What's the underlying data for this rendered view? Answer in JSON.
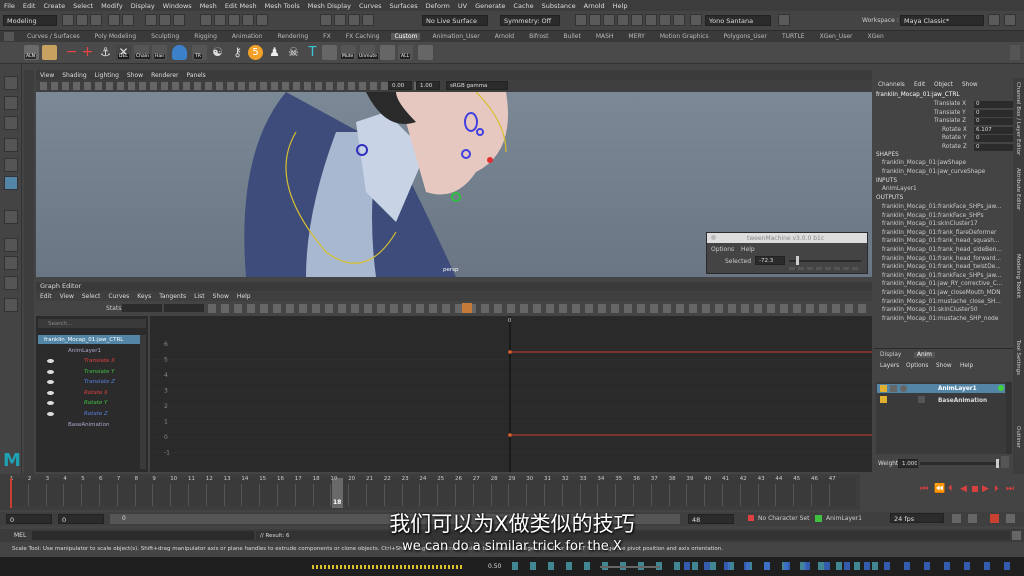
{
  "menubar": [
    "File",
    "Edit",
    "Create",
    "Select",
    "Modify",
    "Display",
    "Windows",
    "Mesh",
    "Edit Mesh",
    "Mesh Tools",
    "Mesh Display",
    "Curves",
    "Surfaces",
    "Deform",
    "UV",
    "Generate",
    "Cache",
    "Substance",
    "Arnold",
    "Help"
  ],
  "statusline": {
    "mode": "Modeling",
    "live_surface": "No Live Surface",
    "symmetry": "Symmetry: Off",
    "user": "Yono Santana",
    "workspace_label": "Workspace :",
    "workspace": "Maya Classic*"
  },
  "shelf_tabs": [
    "Curves / Surfaces",
    "Poly Modeling",
    "Sculpting",
    "Rigging",
    "Animation",
    "Rendering",
    "FX",
    "FX Caching",
    "Custom",
    "Animation_User",
    "Arnold",
    "Bifrost",
    "Bullet",
    "MASH",
    "MERY",
    "Motion Graphics",
    "Polygons_User",
    "TURTLE",
    "XGen_User",
    "XGen"
  ],
  "shelf_active": "Custom",
  "shelf_labels": [
    "ALN",
    "DEL",
    "Chain",
    "Hair",
    "TR",
    "Mute",
    "Unmute",
    "ALL"
  ],
  "viewport": {
    "menu": [
      "View",
      "Shading",
      "Lighting",
      "Show",
      "Renderer",
      "Panels"
    ],
    "field1": "0.00",
    "field2": "1.00",
    "color_space": "sRGB gamma",
    "camera": "persp"
  },
  "tween": {
    "title": "tweenMachine v3.0.0 b1c",
    "menu": [
      "Options",
      "Help"
    ],
    "label": "Selected",
    "value": "-72.3"
  },
  "graph_editor": {
    "title": "Graph Editor",
    "menu": [
      "Edit",
      "View",
      "Select",
      "Curves",
      "Keys",
      "Tangents",
      "List",
      "Show",
      "Help"
    ],
    "stats_label": "Stats",
    "search_placeholder": "Search...",
    "root": "franklin_Mocap_01:jaw_CTRL",
    "layer": "AnimLayer1",
    "channels": [
      {
        "label": "Translate X",
        "color": "#e04040"
      },
      {
        "label": "Translate Y",
        "color": "#40c040"
      },
      {
        "label": "Translate Z",
        "color": "#5a7fe0"
      },
      {
        "label": "Rotate X",
        "color": "#e04040"
      },
      {
        "label": "Rotate Y",
        "color": "#40c040"
      },
      {
        "label": "Rotate Z",
        "color": "#5a7fe0"
      }
    ],
    "base": "BaseAnimation",
    "y_ticks": [
      "6",
      "5",
      "4",
      "3",
      "2",
      "1",
      "0",
      "-1"
    ],
    "current_frame_marker": "0",
    "curve_color": "#c84030"
  },
  "channel_box": {
    "tabs": [
      "Channels",
      "Edit",
      "Object",
      "Show"
    ],
    "object": "franklin_Mocap_01:jaw_CTRL",
    "attrs": [
      {
        "name": "Translate X",
        "value": "0"
      },
      {
        "name": "Translate Y",
        "value": "0"
      },
      {
        "name": "Translate Z",
        "value": "0"
      },
      {
        "name": "Rotate X",
        "value": "6.107"
      },
      {
        "name": "Rotate Y",
        "value": "0"
      },
      {
        "name": "Rotate Z",
        "value": "0"
      }
    ],
    "shapes_header": "SHAPES",
    "shapes": [
      "franklin_Mocap_01:jawShape",
      "franklin_Mocap_01:jaw_curveShape"
    ],
    "inputs_header": "INPUTS",
    "inputs": [
      "AnimLayer1"
    ],
    "outputs_header": "OUTPUTS",
    "outputs": [
      "franklin_Mocap_01:frankFace_SHPs_jaw...",
      "franklin_Mocap_01:frankFace_SHPs",
      "franklin_Mocap_01:skinCluster17",
      "franklin_Mocap_01:frank_flareDeformer",
      "franklin_Mocap_01:frank_head_squash...",
      "franklin_Mocap_01:frank_head_sideBen...",
      "franklin_Mocap_01:frank_head_forward...",
      "franklin_Mocap_01:frank_head_twistDe...",
      "franklin_Mocap_01:frankFace_SHPs_jaw...",
      "franklin_Mocap_01:jaw_RY_corrective_C...",
      "franklin_Mocap_01:jaw_closeMouth_MDN",
      "franklin_Mocap_01:mustache_close_SH...",
      "franklin_Mocap_01:skinCluster50",
      "franklin_Mocap_01:mustache_SHP_node"
    ]
  },
  "layer_editor": {
    "tabs": [
      "Display",
      "Anim"
    ],
    "menu": [
      "Layers",
      "Options",
      "Show",
      "Help"
    ],
    "layers": [
      "AnimLayer1",
      "BaseAnimation"
    ],
    "weight_label": "Weight",
    "weight": "1.000"
  },
  "side_tabs": [
    "Channel Box / Layer Editor",
    "Attribute Editor",
    "Modeling Toolkit",
    "Tool Settings",
    "Outliner"
  ],
  "timeline": {
    "ticks": [
      "1",
      "2",
      "3",
      "4",
      "5",
      "6",
      "7",
      "8",
      "9",
      "10",
      "11",
      "12",
      "13",
      "14",
      "15",
      "16",
      "17",
      "18",
      "19",
      "20",
      "21",
      "22",
      "23",
      "24",
      "25",
      "26",
      "27",
      "28",
      "29",
      "30",
      "31",
      "32",
      "33",
      "34",
      "35",
      "36",
      "37",
      "38",
      "39",
      "40",
      "41",
      "42",
      "43",
      "44",
      "45",
      "46",
      "47"
    ],
    "current_frame": "18"
  },
  "range": {
    "start": "0",
    "anim_start": "0",
    "inner_start": "0",
    "end": "48",
    "char_set": "No Character Set",
    "anim_layer": "AnimLayer1",
    "fps": "24 fps"
  },
  "command": {
    "lang": "MEL",
    "result": "// Result: 6"
  },
  "help_line": "Scale Tool: Use manipulator to scale object(s). Shift+drag manipulator axis or plane handles to extrude components or clone objects. Ctrl+Shift+drag to constrain scaling to connected edges. Use D or INSERT to change the pivot position and axis orientation.",
  "bottom_bar": {
    "value": "0.50"
  },
  "subtitles": {
    "cn": "我们可以为X做类似的技巧",
    "en": "we can do a similar trick for the X"
  },
  "colors": {
    "accent": "#5285a6",
    "key_red": "#c84030",
    "maya_logo": "#1fa3b4"
  }
}
